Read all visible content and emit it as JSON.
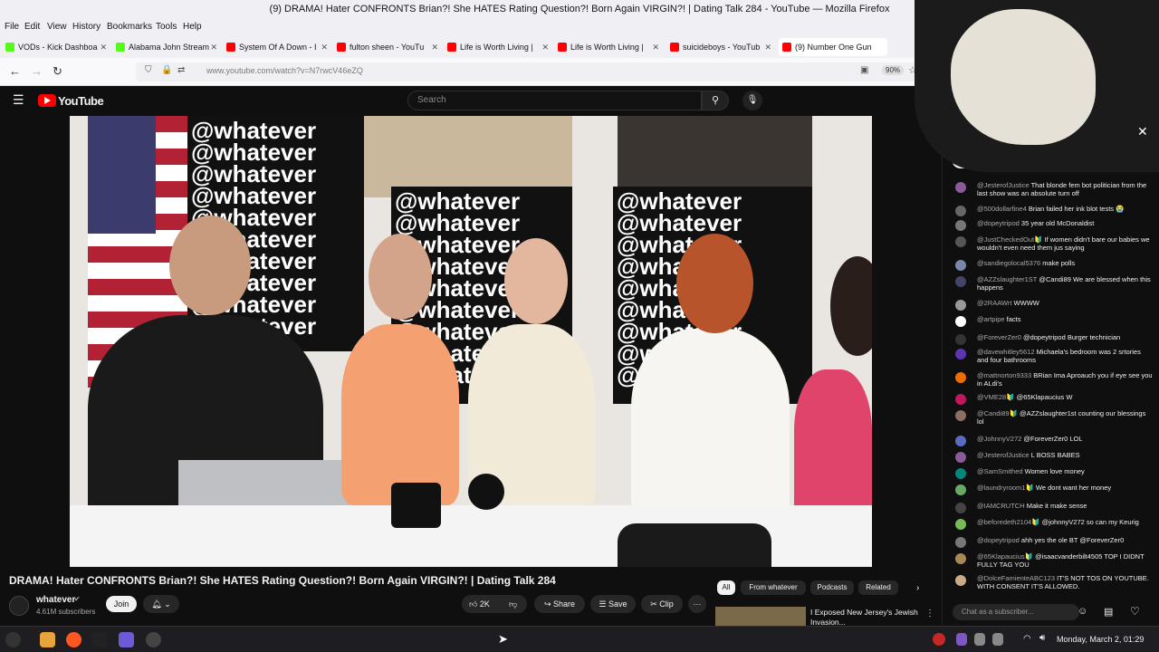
{
  "window": {
    "title": "(9) DRAMA! Hater CONFRONTS Brian?! She HATES Rating Question?! Born Again VIRGIN?! | Dating Talk 284 - YouTube — Mozilla Firefox"
  },
  "menubar": [
    "File",
    "Edit",
    "View",
    "History",
    "Bookmarks",
    "Tools",
    "Help"
  ],
  "tabs": [
    {
      "label": "VODs - Kick Dashboa",
      "color": "#53fc18"
    },
    {
      "label": "Alabama John Stream",
      "color": "#53fc18"
    },
    {
      "label": "System Of A Down - I",
      "color": "#ff0000"
    },
    {
      "label": "fulton sheen - YouTu",
      "color": "#ff0000"
    },
    {
      "label": "Life is Worth Living |",
      "color": "#ff0000"
    },
    {
      "label": "Life is Worth Living |",
      "color": "#ff0000"
    },
    {
      "label": "suicideboys - YouTub",
      "color": "#ff0000"
    },
    {
      "label": "(9) Number One Gun",
      "color": "#ff0000"
    }
  ],
  "navbar": {
    "url": "www.youtube.com/watch?v=N7rwcV46eZQ",
    "zoom": "90%"
  },
  "youtube": {
    "logo_text": "YouTube",
    "search_placeholder": "Search"
  },
  "video": {
    "banner_text": "@whatever",
    "title": "DRAMA! Hater CONFRONTS Brian?! She HATES Rating Question?! Born Again VIRGIN?! | Dating Talk 284",
    "channel": "whatever",
    "subscribers": "4.61M subscribers",
    "join_label": "Join",
    "likes": "2K",
    "share_label": "Share",
    "save_label": "Save",
    "clip_label": "Clip",
    "more_label": "···"
  },
  "chips": [
    "All",
    "From whatever",
    "Podcasts",
    "Related"
  ],
  "suggested": {
    "title": "I Exposed New Jersey's Jewish Invasion..."
  },
  "chat": {
    "messages": [
      {
        "author": "@JesterofJustice",
        "text": "That blonde fem bot politician from the last show was an absolute turn off",
        "color": "#8a5a9a"
      },
      {
        "author": "@500dollarfine4",
        "text": "Brian failed her ink blot tests 😭",
        "color": "#666"
      },
      {
        "author": "@dopeytripod",
        "text": "35 year old McDonaldist",
        "color": "#777"
      },
      {
        "author": "@JustCheckedOut🔰",
        "text": "If women didn't bare our babies we wouldn't even need them jus saying",
        "color": "#555"
      },
      {
        "author": "@sandiegolocal5376",
        "text": "make polls",
        "color": "#7788aa"
      },
      {
        "author": "@AZZslaughter1ST",
        "text": "@Candi89 We are blessed when this happens",
        "color": "#446"
      },
      {
        "author": "@2RAAWrt",
        "text": "WWWW",
        "color": "#999"
      },
      {
        "author": "@artpipe",
        "text": "facts",
        "color": "#fff"
      },
      {
        "author": "@ForeverZer0",
        "text": "@dopeytripod Burger technician",
        "color": "#333"
      },
      {
        "author": "@davewhitley5612",
        "text": "Michaela's bedroom was 2 srtories and four bathrooms",
        "color": "#5e35b1"
      },
      {
        "author": "@mattnorton9333",
        "text": "BRian Ima Aproauch you if eye see you in ALdi's",
        "color": "#ef6c00"
      },
      {
        "author": "@VME28🔰",
        "text": "@65Klapaucius W",
        "color": "#c2185b"
      },
      {
        "author": "@Candi89🔰",
        "text": "@AZZslaughter1st counting our blessings lol",
        "color": "#8d6e63"
      },
      {
        "author": "@JohnnyV272",
        "text": "@ForeverZer0 LOL",
        "color": "#5c6bc0"
      },
      {
        "author": "@JesterofJustice",
        "text": "L BOSS BABES",
        "color": "#8a5a9a"
      },
      {
        "author": "@SamSmithed",
        "text": "Women love money",
        "color": "#00897b"
      },
      {
        "author": "@laundryroom1🔰",
        "text": "We dont want her money",
        "color": "#6a6"
      },
      {
        "author": "@IAMCRUTCH",
        "text": "Make it make sense",
        "color": "#444"
      },
      {
        "author": "@beforedeth2104🔰",
        "text": "@johnnyV272 so can my Keurig",
        "color": "#7b5"
      },
      {
        "author": "@dopeytripod",
        "text": "ahh yes the ole BT @ForeverZer0",
        "color": "#777"
      },
      {
        "author": "@65Klapaucius🔰",
        "text": "@isaacvanderbilt4505 TOP I DIDNT FULLY TAG YOU",
        "color": "#a85"
      },
      {
        "author": "@DolceFamienteABC123",
        "text": "IT'S NOT TOS ON YOUTUBE. WITH CONSENT IT'S ALLOWED.",
        "color": "#ca8"
      }
    ],
    "input_placeholder": "Chat as a subscriber..."
  },
  "taskbar": {
    "clock": "Monday, March  2, 01:29"
  }
}
